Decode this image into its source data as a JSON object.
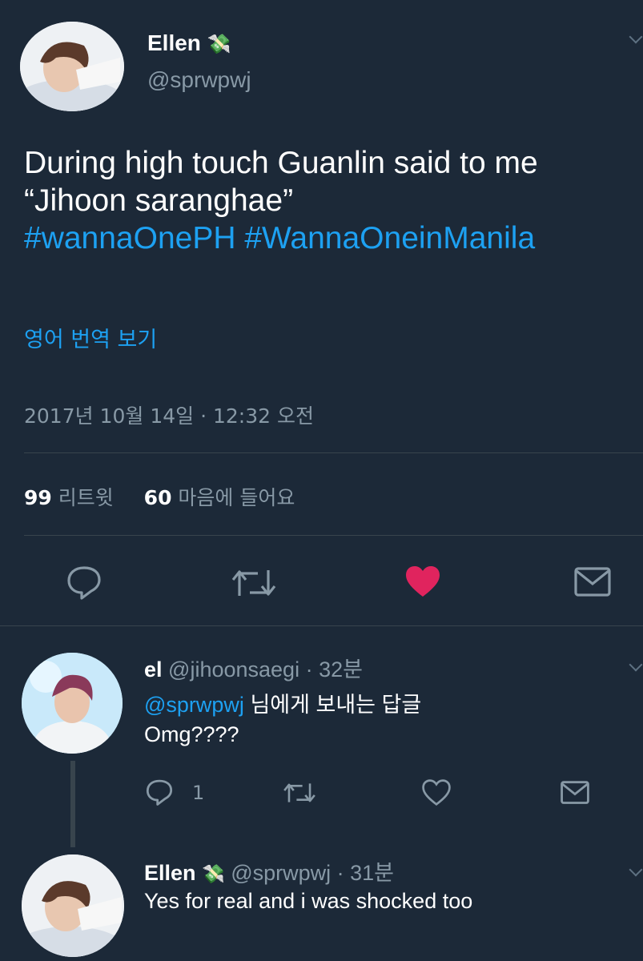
{
  "tweet": {
    "author_name": "Ellen",
    "author_emoji": "💸",
    "author_handle": "@sprwpwj",
    "text_line1": "During high touch Guanlin said to me",
    "text_line2": "“Jihoon saranghae”",
    "hashtag1": "#wannaOnePH",
    "hashtag2": "#WannaOneinManila",
    "translate_label": "영어 번역 보기",
    "timestamp": "2017년 10월 14일 · 12:32 오전",
    "retweet_count": "99",
    "retweet_label": "리트윗",
    "like_count": "60",
    "like_label": "마음에 들어요",
    "liked": true,
    "like_color": "#e0245e"
  },
  "replies": [
    {
      "name": "el",
      "handle": "@jihoonsaegi",
      "time": "· 32분",
      "reply_to_handle": "@sprwpwj",
      "reply_to_suffix": "님에게 보내는 답글",
      "text": "Omg????",
      "reply_count": "1"
    },
    {
      "name": "Ellen",
      "emoji": "💸",
      "handle": "@sprwpwj",
      "time": "· 31분",
      "text": "Yes for real and i was shocked too"
    }
  ],
  "icons": {
    "reply": "reply-icon",
    "retweet": "retweet-icon",
    "like": "heart-icon",
    "dm": "envelope-icon",
    "more": "chevron-down-icon"
  },
  "colors": {
    "background": "#1c2938",
    "accent": "#1da1f2",
    "secondary_text": "#8899a6",
    "divider": "#38444d"
  }
}
